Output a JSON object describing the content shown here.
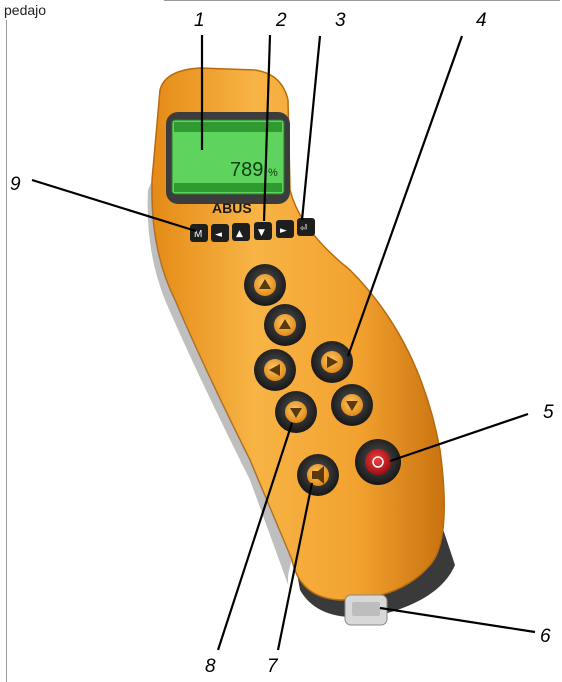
{
  "header": {
    "text": "pedajo"
  },
  "device": {
    "brand": "ABUS",
    "display": {
      "value": "789",
      "unit": "%"
    },
    "keypad": [
      "M",
      "◄",
      "▲",
      "▼",
      "►",
      "⏎"
    ]
  },
  "callouts": [
    "1",
    "2",
    "3",
    "4",
    "5",
    "6",
    "7",
    "8",
    "9"
  ],
  "colors": {
    "body": "#f2a12e",
    "body_dark": "#d9821a",
    "screen": "#5ed35e",
    "stop": "#c4161c"
  }
}
